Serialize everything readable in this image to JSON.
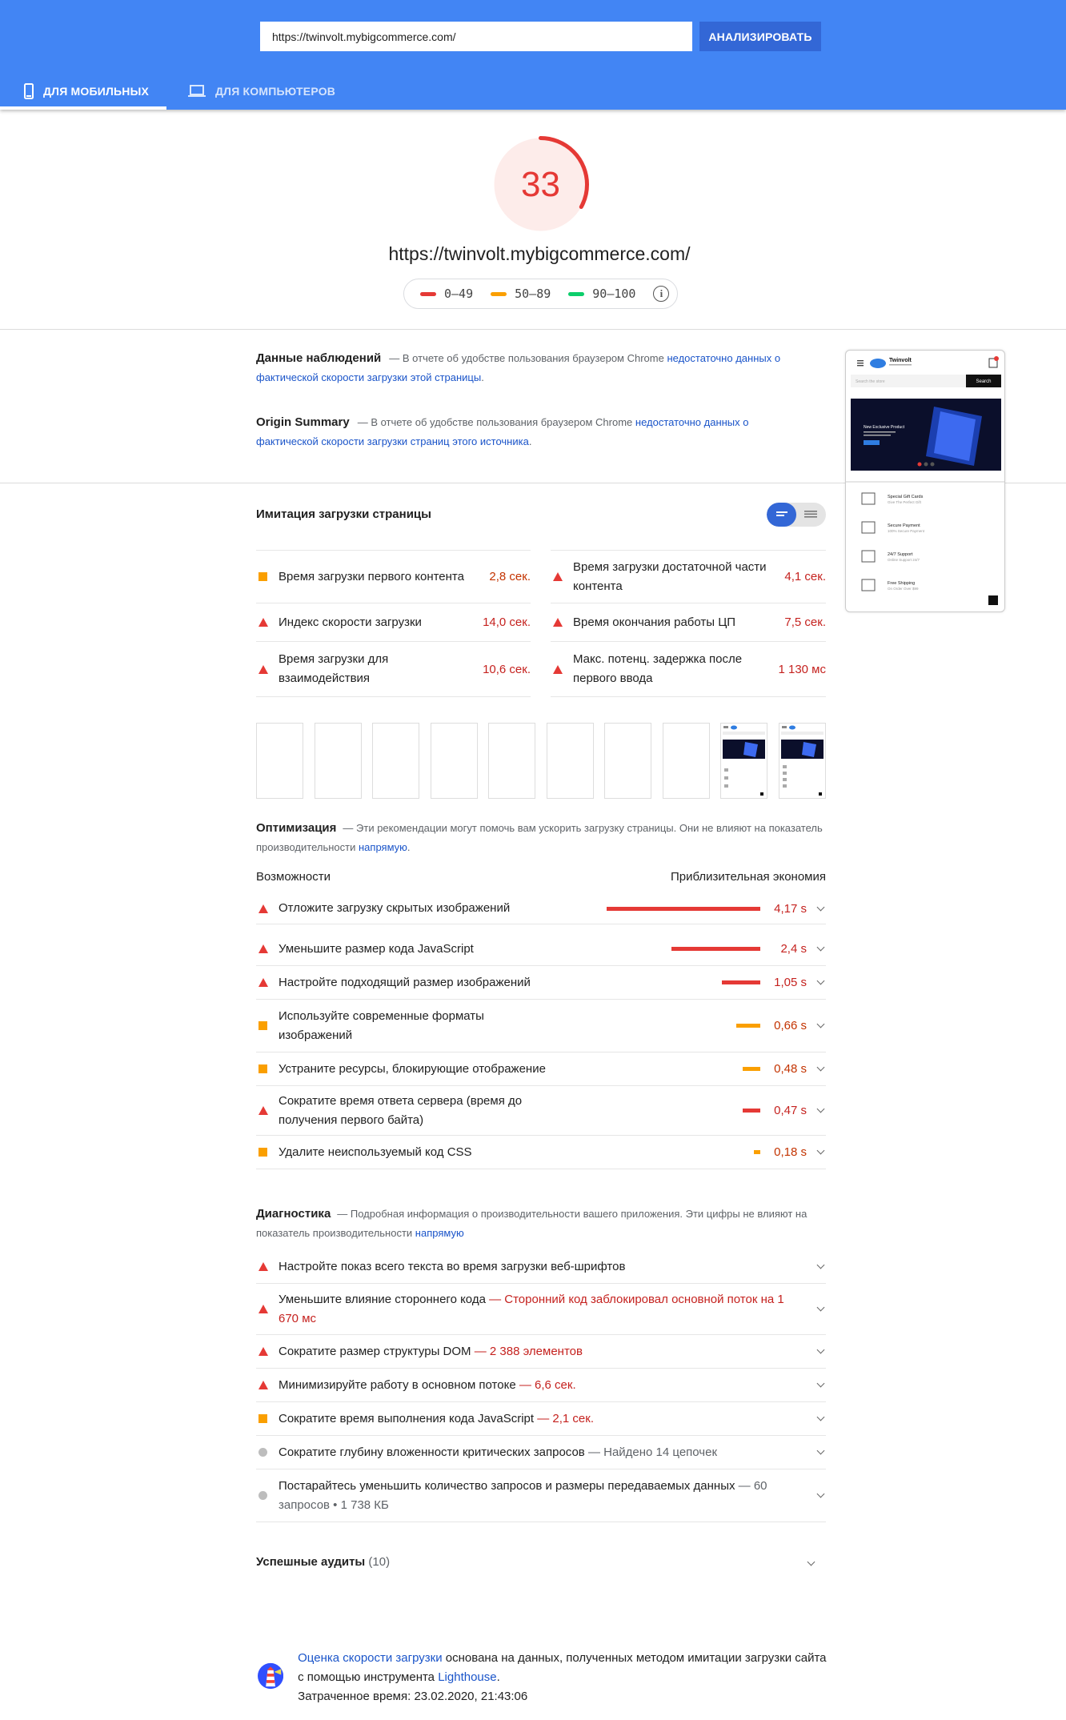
{
  "search": {
    "url_value": "https://twinvolt.mybigcommerce.com/",
    "analyze_label": "АНАЛИЗИРОВАТЬ"
  },
  "tabs": [
    {
      "label": "ДЛЯ МОБИЛЬНЫХ",
      "icon": "smartphone-icon",
      "active": true
    },
    {
      "label": "ДЛЯ КОМПЬЮТЕРОВ",
      "icon": "laptop-icon",
      "active": false
    }
  ],
  "score": {
    "value": "33",
    "fraction": 0.33,
    "color": "#e53935"
  },
  "page_url": "https://twinvolt.mybigcommerce.com/",
  "legend": [
    {
      "label": "0–49",
      "color": "#e53935"
    },
    {
      "label": "50–89",
      "color": "#fa9f00"
    },
    {
      "label": "90–100",
      "color": "#0cce6b"
    }
  ],
  "field_data": {
    "title": "Данные наблюдений",
    "text": "— В отчете об удобстве пользования браузером Chrome",
    "link": "недостаточно данных о фактической скорости загрузки этой страницы",
    "end": "."
  },
  "origin_summary": {
    "title": "Origin Summary",
    "text": "— В отчете об удобстве пользования браузером Chrome",
    "link": "недостаточно данных о фактической скорости загрузки страниц этого источника",
    "end": "."
  },
  "screenshot": {
    "brand": "Twinvolt",
    "search_placeholder": "Search the store",
    "search_button": "Search",
    "hero_title": "New Exclusive Product",
    "features": [
      {
        "title": "Special Gift Cards",
        "sub": "Give The Perfect Gift"
      },
      {
        "title": "Secure Payment",
        "sub": "100% Secure Payment"
      },
      {
        "title": "24/7 Support",
        "sub": "Online Support 24/7"
      },
      {
        "title": "Free Shipping",
        "sub": "On Order Over $99"
      }
    ]
  },
  "lab": {
    "title": "Имитация загрузки страницы",
    "metrics": [
      {
        "label": "Время загрузки первого контента",
        "value": "2,8 сек.",
        "status": "average"
      },
      {
        "label": "Время загрузки достаточной части контента",
        "value": "4,1 сек.",
        "status": "fail"
      },
      {
        "label": "Индекс скорости загрузки",
        "value": "14,0 сек.",
        "status": "fail"
      },
      {
        "label": "Время окончания работы ЦП",
        "value": "7,5 сек.",
        "status": "fail"
      },
      {
        "label": "Время загрузки для взаимодействия",
        "value": "10,6 сек.",
        "status": "fail"
      },
      {
        "label": "Макс. потенц. задержка после первого ввода",
        "value": "1 130 мс",
        "status": "fail"
      }
    ]
  },
  "optimization": {
    "title": "Оптимизация",
    "text": "— Эти рекомендации могут помочь вам ускорить загрузку страницы. Они не влияют на показатель производительности",
    "link": "напрямую",
    "end": ".",
    "col_left": "Возможности",
    "col_right": "Приблизительная экономия",
    "items": [
      {
        "label": "Отложите загрузку скрытых изображений",
        "value": "4,17 s",
        "seconds": 4.17,
        "status": "fail"
      },
      {
        "label": "Уменьшите размер кода JavaScript",
        "value": "2,4 s",
        "seconds": 2.4,
        "status": "fail"
      },
      {
        "label": "Настройте подходящий размер изображений",
        "value": "1,05 s",
        "seconds": 1.05,
        "status": "fail"
      },
      {
        "label": "Используйте современные форматы изображений",
        "value": "0,66 s",
        "seconds": 0.66,
        "status": "average"
      },
      {
        "label": "Устраните ресурсы, блокирующие отображение",
        "value": "0,48 s",
        "seconds": 0.48,
        "status": "average"
      },
      {
        "label": "Сократите время ответа сервера (время до получения первого байта)",
        "value": "0,47 s",
        "seconds": 0.47,
        "status": "fail"
      },
      {
        "label": "Удалите неиспользуемый код CSS",
        "value": "0,18 s",
        "seconds": 0.18,
        "status": "average"
      }
    ]
  },
  "diagnostics": {
    "title": "Диагностика",
    "text": "— Подробная информация о производительности вашего приложения. Эти цифры не влияют на показатель производительности",
    "link": "напрямую",
    "items": [
      {
        "label": "Настройте показ всего текста во время загрузки веб-шрифтов",
        "detail": "",
        "status": "fail"
      },
      {
        "label": "Уменьшите влияние стороннего кода",
        "detail": "— Сторонний код заблокировал основной поток на 1 670 мс",
        "status": "fail"
      },
      {
        "label": "Сократите размер структуры DOM",
        "detail": "— 2 388 элементов",
        "status": "fail"
      },
      {
        "label": "Минимизируйте работу в основном потоке",
        "detail": "— 6,6 сек.",
        "status": "fail"
      },
      {
        "label": "Сократите время выполнения кода JavaScript",
        "detail": "— 2,1 сек.",
        "status": "average"
      },
      {
        "label": "Сократите глубину вложенности критических запросов",
        "detail": "— Найдено 14 цепочек",
        "status": "info"
      },
      {
        "label": "Постарайтесь уменьшить количество запросов и размеры передаваемых данных",
        "detail": "— 60 запросов • 1 738 КБ",
        "status": "info"
      }
    ]
  },
  "passed": {
    "label": "Успешные аудиты",
    "count": "(10)"
  },
  "footer": {
    "link1": "Оценка скорости загрузки",
    "text1": "основана на данных, полученных методом имитации загрузки сайта с помощью инструмента",
    "link2": "Lighthouse",
    "end": ".",
    "time": "Затраченное время: 23.02.2020, 21:43:06"
  }
}
